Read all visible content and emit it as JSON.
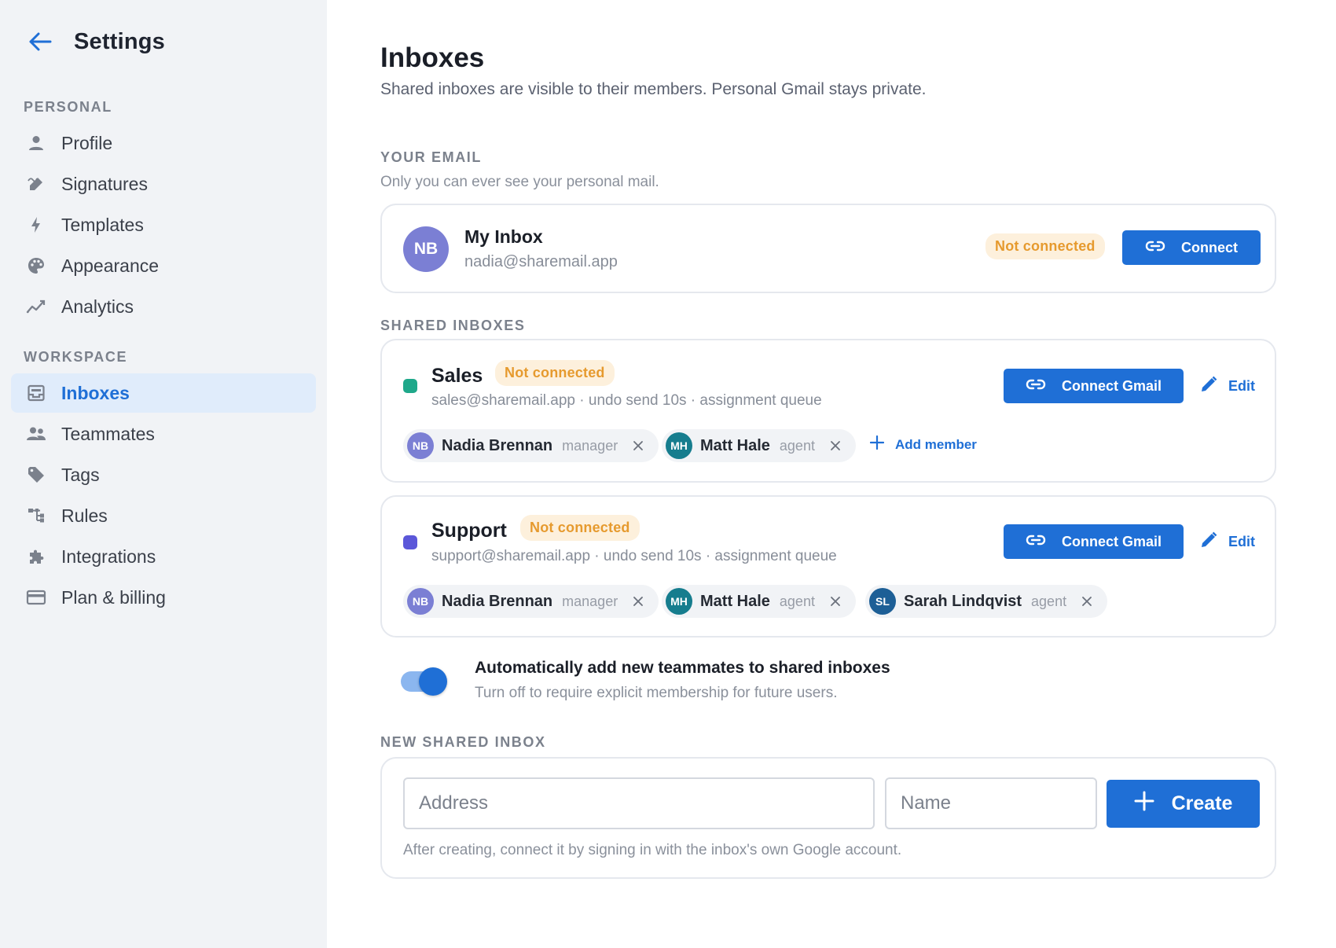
{
  "sidebar": {
    "title": "Settings",
    "sections": [
      {
        "label": "PERSONAL",
        "items": [
          {
            "label": "Profile",
            "icon": "person-icon"
          },
          {
            "label": "Signatures",
            "icon": "signature-icon"
          },
          {
            "label": "Templates",
            "icon": "bolt-icon"
          },
          {
            "label": "Appearance",
            "icon": "palette-icon"
          },
          {
            "label": "Analytics",
            "icon": "chart-line-icon"
          }
        ]
      },
      {
        "label": "WORKSPACE",
        "items": [
          {
            "label": "Inboxes",
            "icon": "inbox-icon",
            "active": true
          },
          {
            "label": "Teammates",
            "icon": "people-icon"
          },
          {
            "label": "Tags",
            "icon": "tag-icon"
          },
          {
            "label": "Rules",
            "icon": "rules-icon"
          },
          {
            "label": "Integrations",
            "icon": "puzzle-icon"
          },
          {
            "label": "Plan & billing",
            "icon": "credit-card-icon"
          }
        ]
      }
    ]
  },
  "main": {
    "title": "Inboxes",
    "subtitle": "Shared inboxes are visible to their members. Personal Gmail stays private.",
    "your_email": {
      "label": "YOUR EMAIL",
      "hint": "Only you can ever see your personal mail.",
      "inbox": {
        "initials": "NB",
        "name": "My Inbox",
        "address": "nadia@sharemail.app",
        "status": "Not connected",
        "connect_label": "Connect"
      }
    },
    "shared": {
      "label": "SHARED INBOXES",
      "inboxes": [
        {
          "name": "Sales",
          "status": "Not connected",
          "meta": "sales@sharemail.app · undo send 10s · assignment queue",
          "dot_color": "#1fa88a",
          "connect_label": "Connect Gmail",
          "edit_label": "Edit",
          "add_member_label": "Add member",
          "members": [
            {
              "initials": "NB",
              "name": "Nadia Brennan",
              "role": "manager",
              "color": "#7b7fd4"
            },
            {
              "initials": "MH",
              "name": "Matt Hale",
              "role": "agent",
              "color": "#167d8e"
            }
          ]
        },
        {
          "name": "Support",
          "status": "Not connected",
          "meta": "support@sharemail.app · undo send 10s · assignment queue",
          "dot_color": "#5b57d9",
          "connect_label": "Connect Gmail",
          "edit_label": "Edit",
          "members": [
            {
              "initials": "NB",
              "name": "Nadia Brennan",
              "role": "manager",
              "color": "#7b7fd4"
            },
            {
              "initials": "MH",
              "name": "Matt Hale",
              "role": "agent",
              "color": "#167d8e"
            },
            {
              "initials": "SL",
              "name": "Sarah Lindqvist",
              "role": "agent",
              "color": "#1d5f96"
            }
          ]
        }
      ]
    },
    "auto_add": {
      "enabled": true,
      "title": "Automatically add new teammates to shared inboxes",
      "hint": "Turn off to require explicit membership for future users."
    },
    "new_inbox": {
      "label": "NEW SHARED INBOX",
      "address_placeholder": "Address",
      "name_placeholder": "Name",
      "create_label": "Create",
      "hint": "After creating, connect it by signing in with the inbox's own Google account."
    }
  },
  "colors": {
    "accent": "#1f6fd6",
    "warning_text": "#e69a2e",
    "warning_bg": "#fdf0dc",
    "sidebar_bg": "#f1f3f6",
    "active_bg": "#e0ecfb"
  }
}
